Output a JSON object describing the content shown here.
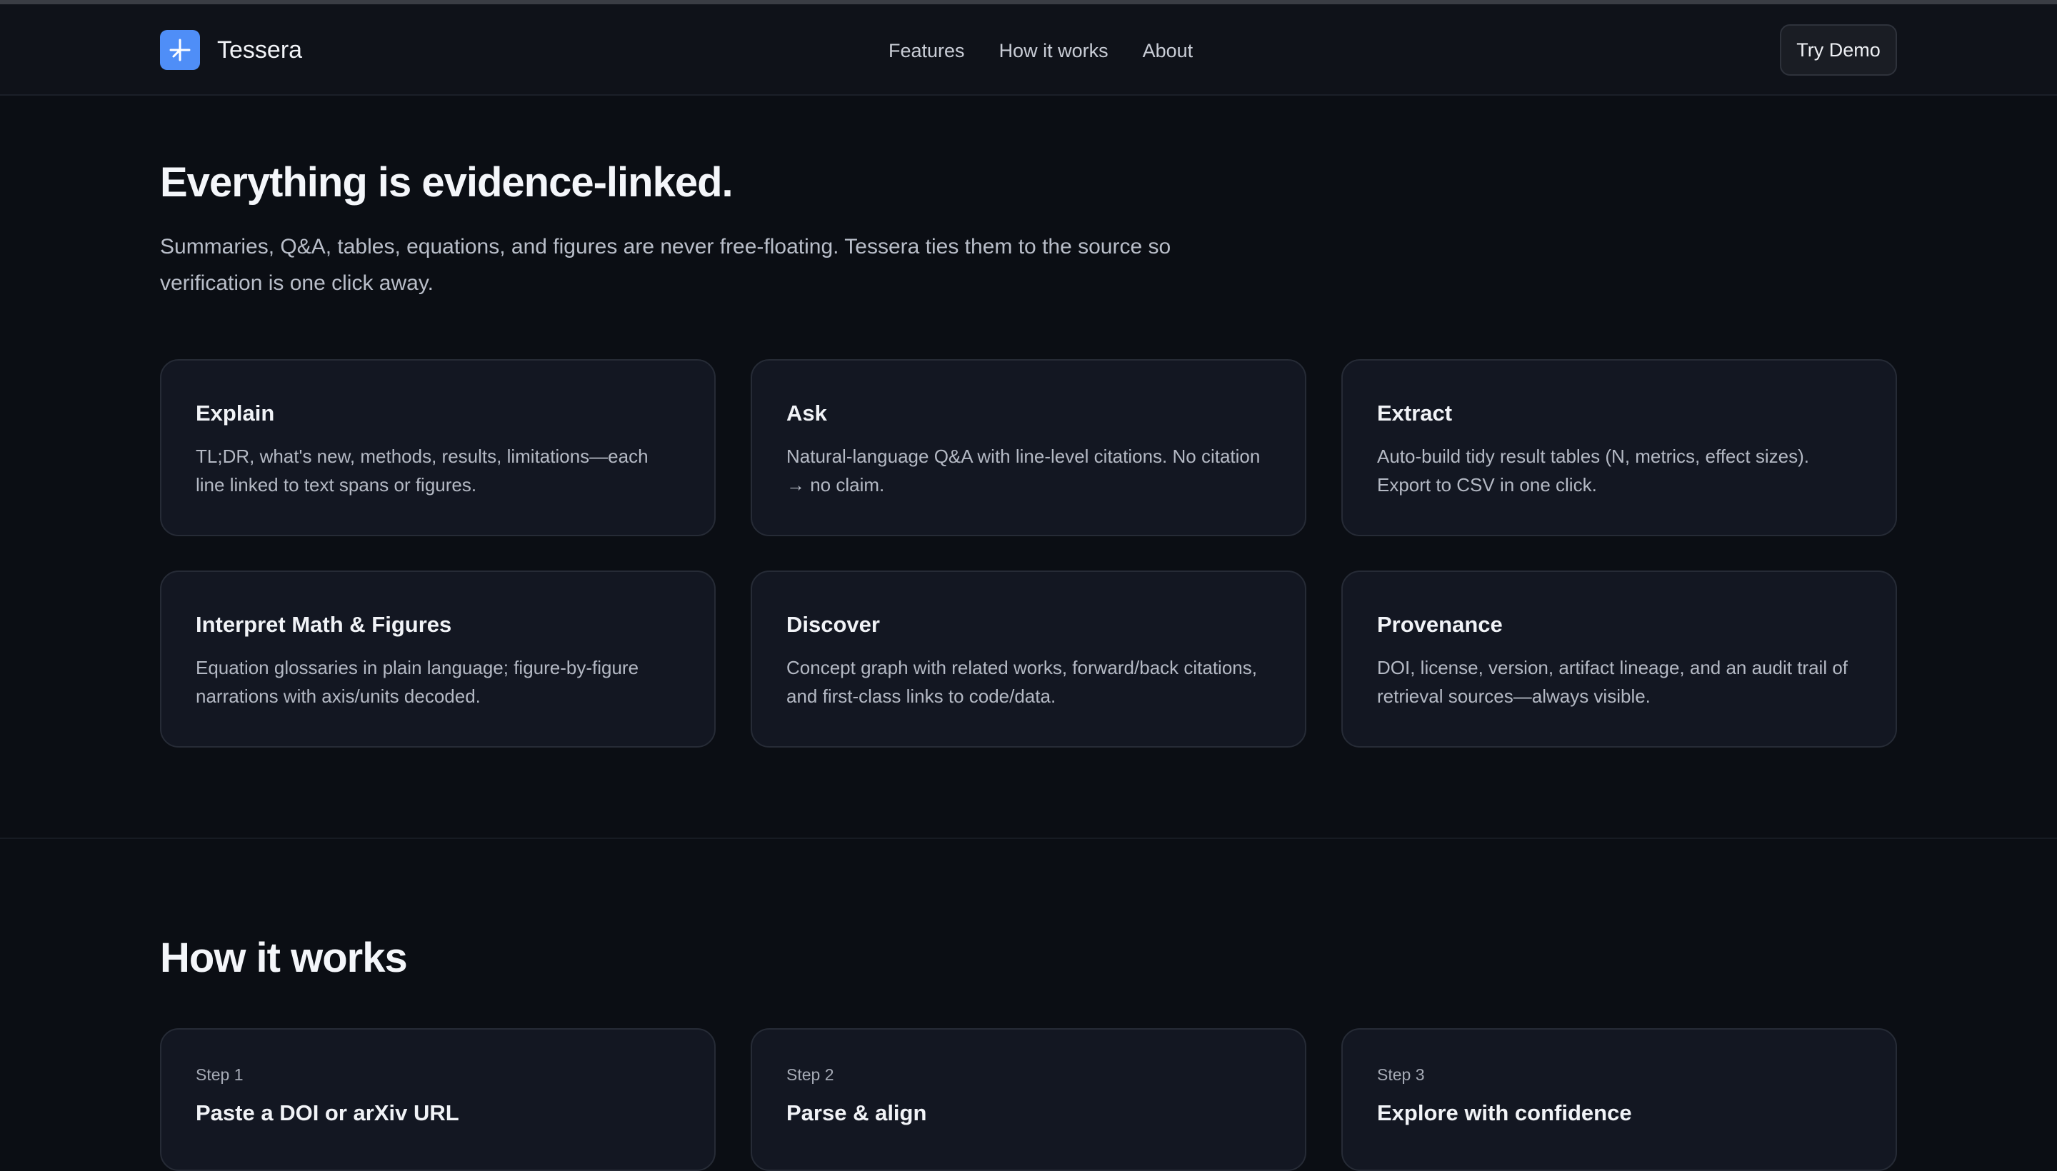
{
  "brand": {
    "name": "Tessera",
    "logo_icon": "sparkle-icon",
    "accent": "#4f8ef7"
  },
  "nav": [
    {
      "label": "Features"
    },
    {
      "label": "How it works"
    },
    {
      "label": "About"
    }
  ],
  "cta": {
    "label": "Try Demo"
  },
  "features": {
    "title": "Everything is evidence-linked.",
    "lede": "Summaries, Q&A, tables, equations, and figures are never free-floating. Tessera ties them to the source so verification is one click away.",
    "cards": [
      {
        "title": "Explain",
        "body": "TL;DR, what's new, methods, results, limitations—each line linked to text spans or figures."
      },
      {
        "title": "Ask",
        "body": "Natural-language Q&A with line-level citations. No citation → no claim."
      },
      {
        "title": "Extract",
        "body": "Auto-build tidy result tables (N, metrics, effect sizes). Export to CSV in one click."
      },
      {
        "title": "Interpret Math & Figures",
        "body": "Equation glossaries in plain language; figure-by-figure narrations with axis/units decoded."
      },
      {
        "title": "Discover",
        "body": "Concept graph with related works, forward/back citations, and first-class links to code/data."
      },
      {
        "title": "Provenance",
        "body": "DOI, license, version, artifact lineage, and an audit trail of retrieval sources—always visible."
      }
    ]
  },
  "how": {
    "title": "How it works",
    "steps": [
      {
        "label": "Step 1",
        "title": "Paste a DOI or arXiv URL"
      },
      {
        "label": "Step 2",
        "title": "Parse & align"
      },
      {
        "label": "Step 3",
        "title": "Explore with confidence"
      }
    ]
  }
}
